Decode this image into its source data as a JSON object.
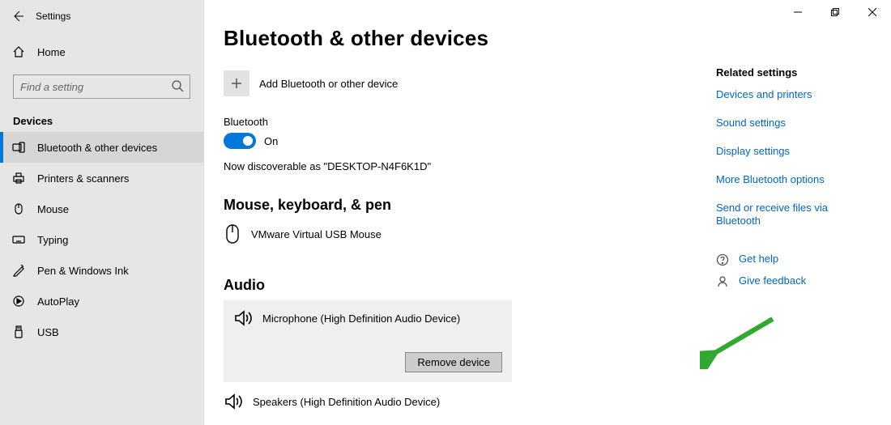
{
  "titlebar": {
    "app_title": "Settings"
  },
  "sidebar": {
    "home": "Home",
    "search_placeholder": "Find a setting",
    "group": "Devices",
    "items": [
      {
        "label": "Bluetooth & other devices"
      },
      {
        "label": "Printers & scanners"
      },
      {
        "label": "Mouse"
      },
      {
        "label": "Typing"
      },
      {
        "label": "Pen & Windows Ink"
      },
      {
        "label": "AutoPlay"
      },
      {
        "label": "USB"
      }
    ]
  },
  "main": {
    "heading": "Bluetooth & other devices",
    "add_label": "Add Bluetooth or other device",
    "bt_label": "Bluetooth",
    "bt_state": "On",
    "discoverable": "Now discoverable as \"DESKTOP-N4F6K1D\"",
    "section_mouse": "Mouse, keyboard, & pen",
    "device_mouse": "VMware Virtual USB Mouse",
    "section_audio": "Audio",
    "device_mic": "Microphone (High Definition Audio Device)",
    "remove_btn": "Remove device",
    "device_speakers": "Speakers (High Definition Audio Device)"
  },
  "right": {
    "heading": "Related settings",
    "links": [
      "Devices and printers",
      "Sound settings",
      "Display settings",
      "More Bluetooth options",
      "Send or receive files via Bluetooth"
    ],
    "help": "Get help",
    "feedback": "Give feedback"
  }
}
